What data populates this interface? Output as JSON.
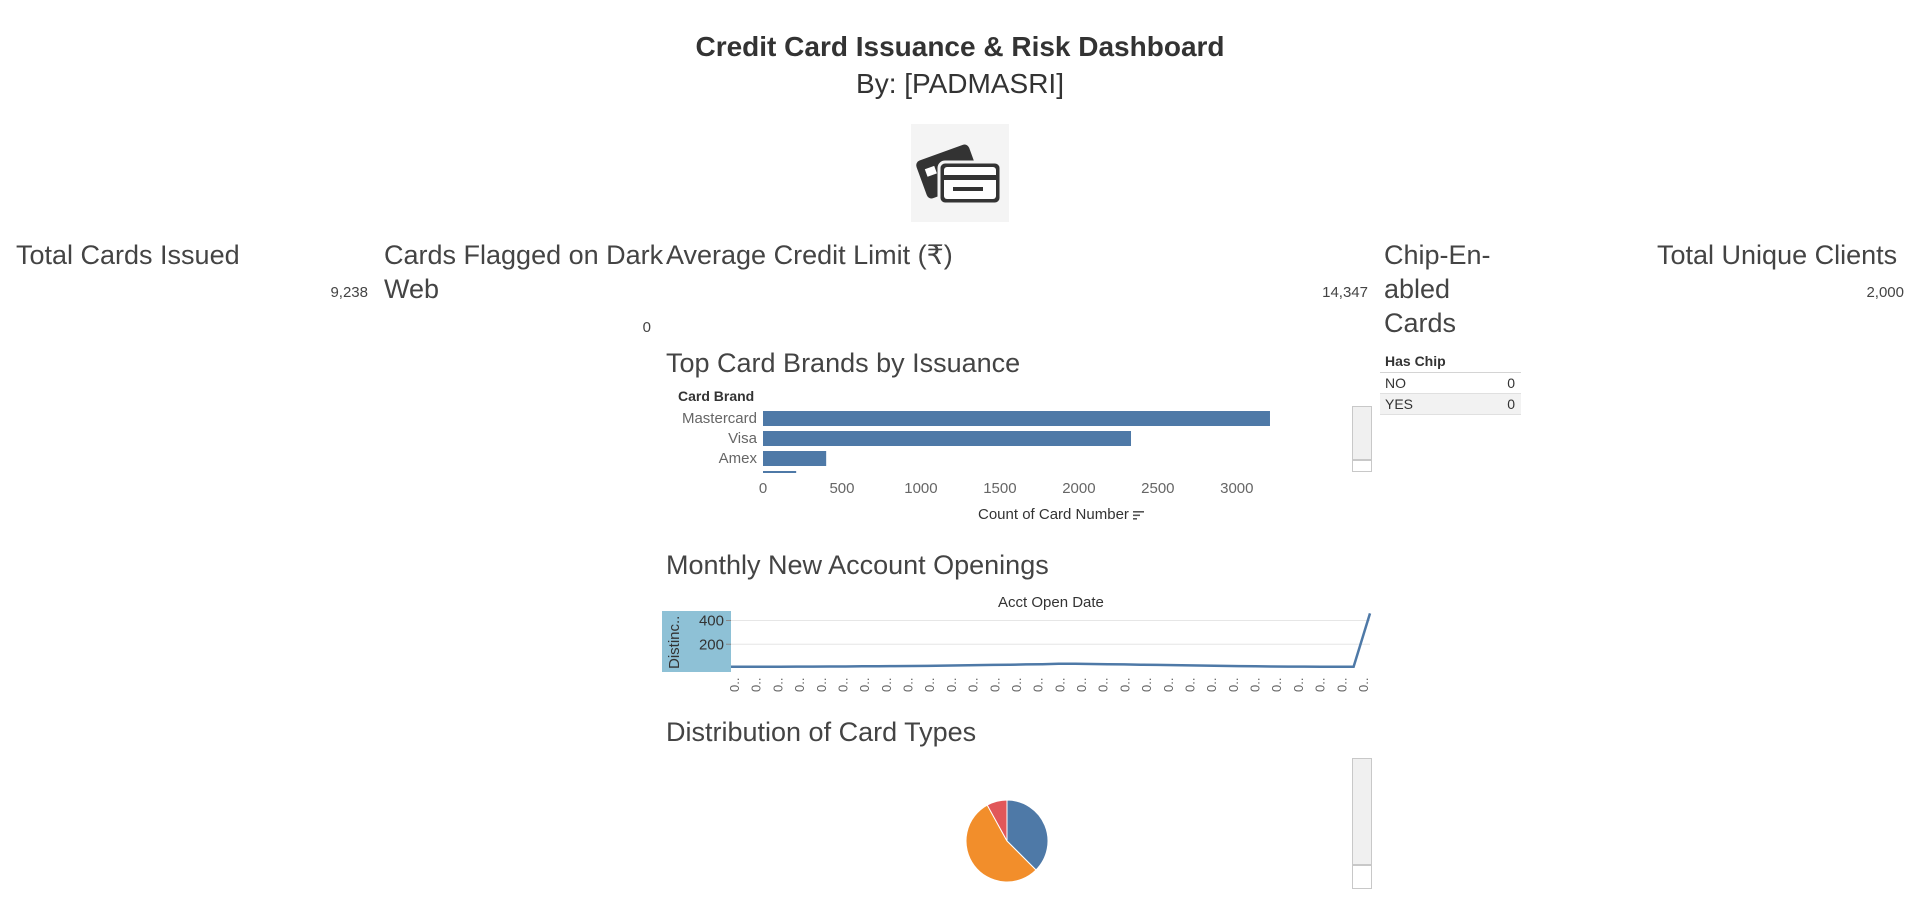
{
  "header": {
    "title": "Credit Card Issuance & Risk Dashboard",
    "subtitle": "By: [PADMASRI]"
  },
  "logo": {
    "icon": "credit-cards-icon"
  },
  "kpis": {
    "total_cards": {
      "label": "Total Cards Issued",
      "value": "9,238"
    },
    "dark_web": {
      "label_line1": "Cards Flagged on Dark",
      "label_line2": "Web",
      "value": "0"
    },
    "avg_limit": {
      "label": "Average Credit Limit (₹)",
      "value": "14,347"
    },
    "chip": {
      "label_line1": "Chip-En-",
      "label_line2": "abled",
      "label_line3": "Cards"
    },
    "unique_clients": {
      "label": "Total Unique Clients",
      "value": "2,000"
    }
  },
  "chip_table": {
    "header": "Has Chip",
    "rows": [
      {
        "label": "NO",
        "value": "0"
      },
      {
        "label": "YES",
        "value": "0"
      }
    ]
  },
  "brands_section": {
    "title": "Top Card Brands by Issuance",
    "row_header": "Card Brand",
    "axis_title": "Count of Card Number",
    "sort_icon": "sort-descending-icon"
  },
  "monthly_section": {
    "title": "Monthly New Account Openings",
    "col_header": "Acct Open Date",
    "y_title": "Distinc..",
    "x_tick_label": "0.."
  },
  "types_section": {
    "title": "Distribution of Card Types"
  },
  "colors": {
    "primary": "#4e79a7",
    "orange": "#f28e2b",
    "red": "#e15759",
    "highlight": "#8ec1d6"
  },
  "chart_data": [
    {
      "type": "bar",
      "title": "Top Card Brands by Issuance",
      "categories": [
        "Mastercard",
        "Visa",
        "Amex",
        ""
      ],
      "values": [
        3210,
        2330,
        400,
        210
      ],
      "ylabel": "Card Brand",
      "xlabel": "Count of Card Number",
      "xlim": [
        0,
        3400
      ],
      "x_ticks": [
        0,
        500,
        1000,
        1500,
        2000,
        2500,
        3000
      ]
    },
    {
      "type": "line",
      "title": "Monthly New Account Openings",
      "xlabel": "Acct Open Date",
      "ylabel": "Distinc..",
      "y_ticks": [
        400,
        200
      ],
      "ylim": [
        0,
        480
      ],
      "values": [
        10,
        10,
        11,
        11,
        12,
        12,
        13,
        13,
        14,
        15,
        16,
        17,
        18,
        20,
        22,
        24,
        26,
        28,
        30,
        32,
        35,
        36,
        34,
        32,
        30,
        28,
        26,
        24,
        22,
        20,
        18,
        16,
        14,
        13,
        12,
        12,
        11,
        10,
        11,
        460
      ]
    },
    {
      "type": "pie",
      "title": "Distribution of Card Types",
      "slices": [
        {
          "value": 0.375,
          "color": "#4e79a7"
        },
        {
          "value": 0.545,
          "color": "#f28e2b"
        },
        {
          "value": 0.08,
          "color": "#e15759"
        }
      ]
    }
  ]
}
